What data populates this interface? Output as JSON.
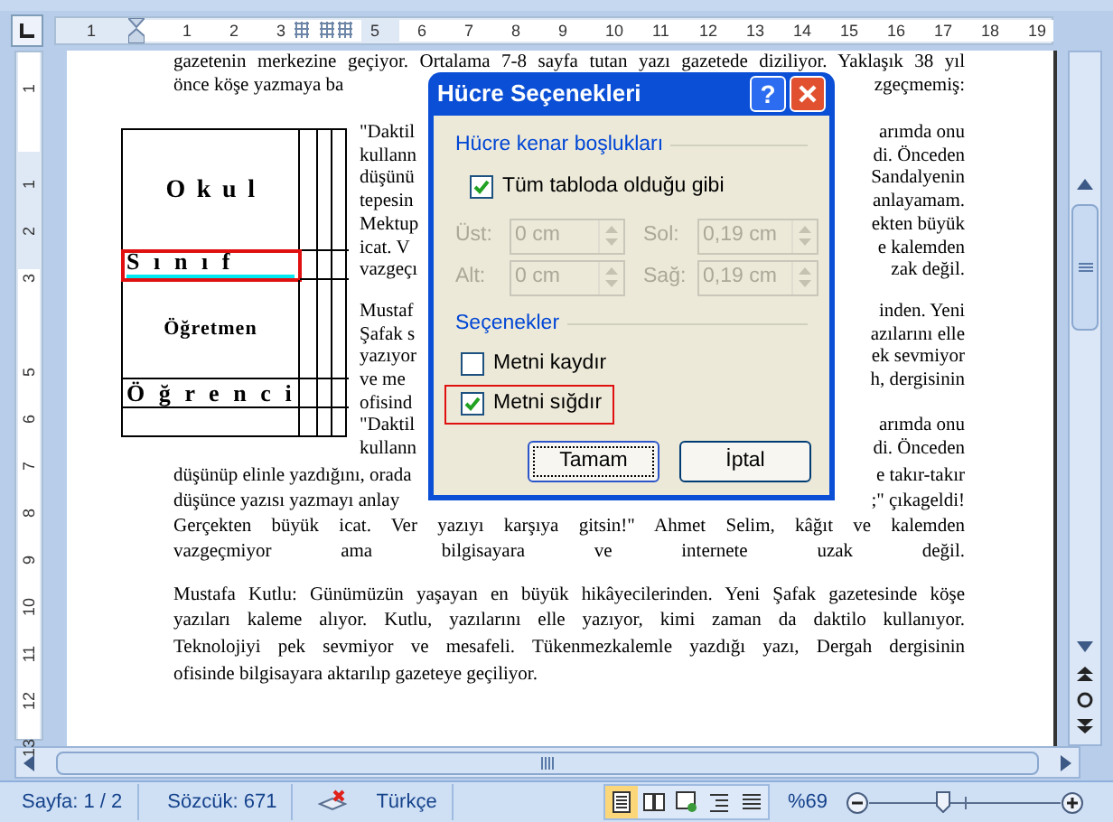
{
  "ruler": {
    "top_labels": [
      "1",
      "1",
      "2",
      "3",
      "5",
      "6",
      "7",
      "8",
      "9",
      "10",
      "11",
      "12",
      "13",
      "14",
      "15",
      "16",
      "17",
      "18",
      "19"
    ],
    "side_labels": [
      "1",
      "1",
      "2",
      "3",
      "5",
      "6",
      "7",
      "8",
      "9",
      "10",
      "11",
      "12",
      "13"
    ]
  },
  "document": {
    "intro_lines": [
      {
        "text": "gazetenin merkezine geçiyor. Ortalama 7-8 sayfa tutan yazı gazetede diziliyor. Yaklaşık 38 yıl"
      },
      {
        "left": "önce köşe yazmaya ba",
        "right": "zgeçmemiş:"
      }
    ],
    "table": {
      "rows": [
        {
          "text": "Okul",
          "kind": "spaced",
          "selected": false
        },
        {
          "text": "Sınıf",
          "kind": "wide",
          "selected": true
        },
        {
          "text": "Öğretmen",
          "kind": "narrow",
          "selected": false
        },
        {
          "text": "Öğrenci",
          "kind": "wide",
          "selected": false
        },
        {
          "text": "",
          "kind": "empty",
          "selected": false
        }
      ]
    },
    "side_lines": [
      {
        "left": "\"Daktil",
        "right": "arımda onu"
      },
      {
        "left": "kullann",
        "right": "di. Önceden"
      },
      {
        "left": "düşünü",
        "right": "Sandalyenin"
      },
      {
        "left": "tepesin",
        "right": "anlayamam."
      },
      {
        "left": "Mektup",
        "right": "ekten büyük"
      },
      {
        "left": "icat. V",
        "right": "e kalemden"
      },
      {
        "left": "vazgeçı",
        "right": "zak değil."
      },
      {
        "kind": "blank"
      },
      {
        "left": "Mustaf",
        "right": "inden. Yeni"
      },
      {
        "left": "Şafak s",
        "right": "azılarını elle"
      },
      {
        "left": "yazıyor",
        "right": "ek sevmiyor"
      },
      {
        "left": "ve me",
        "right": "h, dergisinin"
      },
      {
        "left": "ofisind"
      },
      {
        "left": "\"Daktil",
        "right": "arımda onu"
      },
      {
        "left": "kullann",
        "right": "di. Önceden"
      }
    ],
    "lines": [
      {
        "left": "düşünüp elinle yazdığını, orada",
        "right": "e takır-takır"
      },
      {
        "left": "düşünce yazısı yazmayı anlay",
        "right": ";\" çıkageldi!"
      },
      {
        "text": "Gerçekten büyük icat. Ver yazıyı karşıya gitsin!\" Ahmet Selim, kâğıt ve kalemden"
      },
      {
        "text": "vazgeçmiyor ama bilgisayara ve internete uzak değil."
      },
      {
        "kind": "blank"
      },
      {
        "text": "Mustafa Kutlu: Günümüzün yaşayan en büyük hikâyecilerinden. Yeni Şafak gazetesinde köşe"
      },
      {
        "text": "yazıları kaleme alıyor. Kutlu, yazılarını elle yazıyor, kimi zaman da daktilo kullanıyor."
      },
      {
        "text": "Teknolojiyi pek sevmiyor ve mesafeli. Tükenmezkalemle yazdığı yazı, Dergah dergisinin"
      },
      {
        "text": "ofisinde bilgisayara aktarılıp gazeteye geçiliyor.",
        "kind": "last"
      }
    ]
  },
  "dialog": {
    "title": "Hücre Seçenekleri",
    "help": "?",
    "margins_group": "Hücre kenar boşlukları",
    "same_as_table": {
      "label": "Tüm tabloda olduğu gibi",
      "checked": true
    },
    "fields": [
      {
        "label": "Üst:",
        "value": "0 cm",
        "disabled": true
      },
      {
        "label": "Sol:",
        "value": "0,19 cm",
        "disabled": true
      },
      {
        "label": "Alt:",
        "value": "0 cm",
        "disabled": true
      },
      {
        "label": "Sağ:",
        "value": "0,19 cm",
        "disabled": true
      }
    ],
    "options_group": "Seçenekler",
    "options": [
      {
        "label": "Metni kaydır",
        "checked": false,
        "highlighted": false
      },
      {
        "label": "Metni sığdır",
        "checked": true,
        "highlighted": true
      }
    ],
    "buttons": [
      {
        "label": "Tamam",
        "focused": true
      },
      {
        "label": "İptal",
        "focused": false
      }
    ]
  },
  "status_bar": {
    "page": "Sayfa: 1 / 2",
    "words": "Sözcük: 671",
    "language": "Türkçe",
    "views": [
      {
        "kind": "page",
        "selected": true
      },
      {
        "kind": "book",
        "selected": false
      },
      {
        "kind": "web",
        "selected": false
      },
      {
        "kind": "outline",
        "selected": false
      },
      {
        "kind": "draft",
        "selected": false
      }
    ],
    "zoom": "%69",
    "zoom_level": {
      "level": 0.38
    }
  }
}
